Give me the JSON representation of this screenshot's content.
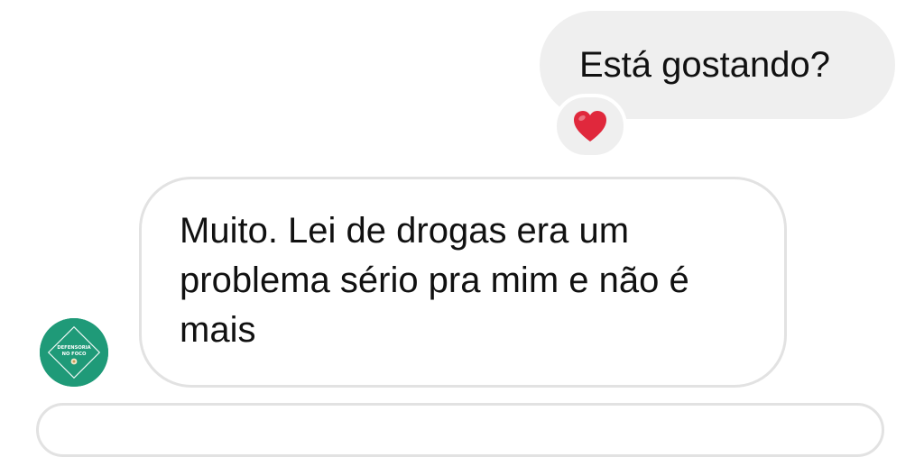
{
  "messages": [
    {
      "direction": "outgoing",
      "text": "Está gostando?",
      "reaction": "❤️"
    },
    {
      "direction": "incoming",
      "text": "Muito. Lei de drogas era um problema sério pra mim e não é mais"
    }
  ],
  "avatar": {
    "line1": "DEFENSORIA",
    "line2": "NO FOCO",
    "color": "#1f9a78"
  },
  "colors": {
    "outgoing_bubble": "#efefef",
    "incoming_border": "#e2e2e2",
    "reaction_heart": "#e0283c"
  }
}
